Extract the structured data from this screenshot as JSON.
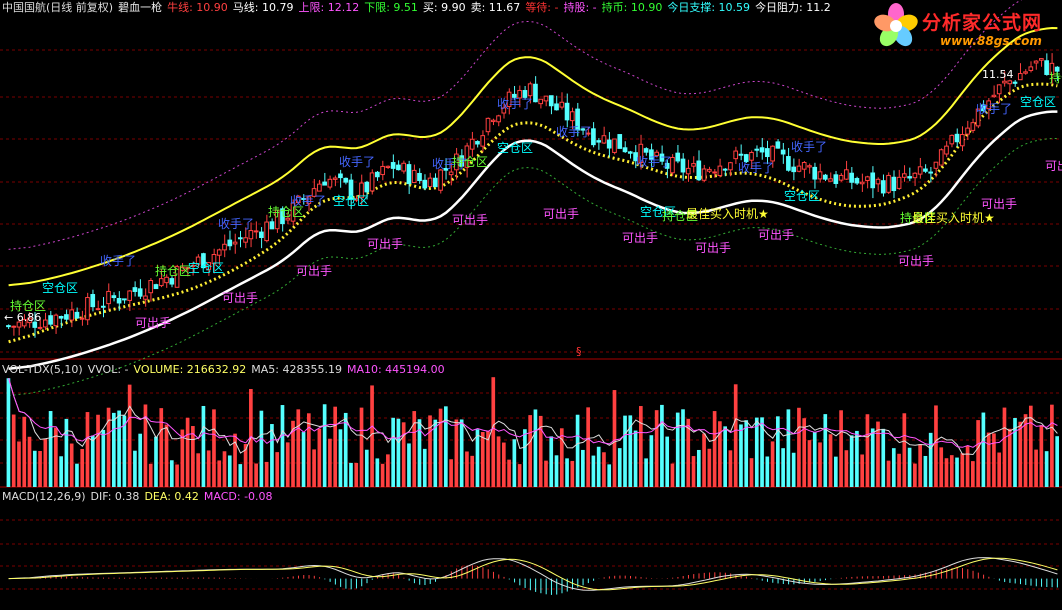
{
  "main_header": {
    "stock": "中国国航(日线 前复权)",
    "indicator": "碧血一枪",
    "items": [
      {
        "label": "牛线: ",
        "value": "10.90",
        "color": "#ff4040"
      },
      {
        "label": "马线: ",
        "value": "10.79",
        "color": "#ffffff"
      },
      {
        "label": "上限: ",
        "value": "12.12",
        "color": "#ff55ff"
      },
      {
        "label": "下限: ",
        "value": "9.51",
        "color": "#33ff33"
      },
      {
        "label": "买: ",
        "value": "9.90",
        "color": "#ffffff"
      },
      {
        "label": "卖: ",
        "value": "11.67",
        "color": "#ffffff"
      },
      {
        "label": "等待: ",
        "value": "-",
        "color": "#ff3333"
      },
      {
        "label": "持股: ",
        "value": "-",
        "color": "#ff55ff"
      },
      {
        "label": "持币: ",
        "value": "10.90",
        "color": "#33ff33"
      },
      {
        "label": "今日支撑: ",
        "value": "10.59",
        "color": "#33ffff"
      },
      {
        "label": "今日阻力: ",
        "value": "11.2",
        "color": "#ffffff"
      }
    ]
  },
  "watermark": {
    "title": "分析家公式网",
    "url": "www.88gs.com"
  },
  "main_chart": {
    "price_high_label": "11.54",
    "price_low_label": "← 6.86",
    "labels": [
      {
        "text": "持仓区",
        "color": "#66ff33",
        "x": 10,
        "y": 310
      },
      {
        "text": "空仓区",
        "color": "#00ffff",
        "x": 42,
        "y": 292
      },
      {
        "text": "收手了",
        "color": "#4466ff",
        "x": 100,
        "y": 265
      },
      {
        "text": "可出手",
        "color": "#ff55ff",
        "x": 135,
        "y": 327
      },
      {
        "text": "持仓区",
        "color": "#66ff33",
        "x": 155,
        "y": 275
      },
      {
        "text": "空仓区",
        "color": "#00ffff",
        "x": 188,
        "y": 272
      },
      {
        "text": "收手了",
        "color": "#4466ff",
        "x": 218,
        "y": 228
      },
      {
        "text": "可出手",
        "color": "#ff55ff",
        "x": 222,
        "y": 302
      },
      {
        "text": "持仓区",
        "color": "#66ff33",
        "x": 268,
        "y": 216
      },
      {
        "text": "收手了",
        "color": "#4466ff",
        "x": 290,
        "y": 205
      },
      {
        "text": "可出手",
        "color": "#ff55ff",
        "x": 296,
        "y": 275
      },
      {
        "text": "空仓区",
        "color": "#00ffff",
        "x": 333,
        "y": 205
      },
      {
        "text": "收手了",
        "color": "#4466ff",
        "x": 339,
        "y": 166
      },
      {
        "text": "可出手",
        "color": "#ff55ff",
        "x": 367,
        "y": 248
      },
      {
        "text": "收手了",
        "color": "#4466ff",
        "x": 432,
        "y": 168
      },
      {
        "text": "持仓区",
        "color": "#66ff33",
        "x": 452,
        "y": 166
      },
      {
        "text": "可出手",
        "color": "#ff55ff",
        "x": 452,
        "y": 224
      },
      {
        "text": "空仓区",
        "color": "#00ffff",
        "x": 497,
        "y": 152
      },
      {
        "text": "收手了",
        "color": "#4466ff",
        "x": 497,
        "y": 108
      },
      {
        "text": "可出手",
        "color": "#ff55ff",
        "x": 543,
        "y": 218
      },
      {
        "text": "收手了",
        "color": "#4466ff",
        "x": 556,
        "y": 136
      },
      {
        "text": "可出手",
        "color": "#ff55ff",
        "x": 622,
        "y": 242
      },
      {
        "text": "收手了",
        "color": "#4466ff",
        "x": 636,
        "y": 166
      },
      {
        "text": "空仓区",
        "color": "#00ffff",
        "x": 640,
        "y": 216
      },
      {
        "text": "持仓区",
        "color": "#66ff33",
        "x": 662,
        "y": 220
      },
      {
        "text": "最佳买入时机★",
        "color": "#ffff33",
        "x": 686,
        "y": 218
      },
      {
        "text": "可出手",
        "color": "#ff55ff",
        "x": 695,
        "y": 252
      },
      {
        "text": "收手了",
        "color": "#4466ff",
        "x": 738,
        "y": 172
      },
      {
        "text": "可出手",
        "color": "#ff55ff",
        "x": 758,
        "y": 239
      },
      {
        "text": "空仓区",
        "color": "#00ffff",
        "x": 784,
        "y": 200
      },
      {
        "text": "收手了",
        "color": "#4466ff",
        "x": 791,
        "y": 151
      },
      {
        "text": "持仓区",
        "color": "#66ff33",
        "x": 900,
        "y": 222
      },
      {
        "text": "最佳买入时机★",
        "color": "#ffff33",
        "x": 912,
        "y": 222
      },
      {
        "text": "可出手",
        "color": "#ff55ff",
        "x": 898,
        "y": 265
      },
      {
        "text": "收手了",
        "color": "#4466ff",
        "x": 976,
        "y": 113
      },
      {
        "text": "可出手",
        "color": "#ff55ff",
        "x": 981,
        "y": 208
      },
      {
        "text": "空仓区",
        "color": "#00ffff",
        "x": 1020,
        "y": 106
      },
      {
        "text": "持仓区",
        "color": "#66ff33",
        "x": 1049,
        "y": 82
      },
      {
        "text": "可出手",
        "color": "#ff55ff",
        "x": 1045,
        "y": 170
      }
    ]
  },
  "volume_header": {
    "name": "VOL-TDX(5,10)",
    "items": [
      {
        "label": "VVOL: ",
        "value": "-",
        "color": "#dddddd"
      },
      {
        "label": "VOLUME: ",
        "value": "216632.92",
        "color": "#ffff66"
      },
      {
        "label": "MA5: ",
        "value": "428355.19",
        "color": "#dddddd"
      },
      {
        "label": "MA10: ",
        "value": "445194.00",
        "color": "#ff55ff"
      }
    ]
  },
  "macd_header": {
    "name": "MACD(12,26,9)",
    "items": [
      {
        "label": "DIF: ",
        "value": "0.38",
        "color": "#dddddd"
      },
      {
        "label": "DEA: ",
        "value": "0.42",
        "color": "#ffff66"
      },
      {
        "label": "MACD: ",
        "value": "-0.08",
        "color": "#ff55ff"
      }
    ]
  },
  "separator_marker": "§",
  "colors": {
    "up": "#ff4040",
    "down": "#54ffff",
    "grid": "#7a0000",
    "pane_border": "#aa0000",
    "upper_band": "#cc44cc",
    "lower_band": "#33aa33",
    "yellow_line": "#ffff33",
    "white_line": "#ffffff"
  },
  "chart_data": {
    "type": "candlestick",
    "series": [
      {
        "name": "price_close_profile",
        "points": [
          [
            0,
            7.0
          ],
          [
            5,
            7.2
          ],
          [
            10,
            7.5
          ],
          [
            15,
            7.9
          ],
          [
            20,
            8.4
          ],
          [
            25,
            8.9
          ],
          [
            28,
            9.5
          ],
          [
            31,
            9.2
          ],
          [
            34,
            9.7
          ],
          [
            37,
            9.4
          ],
          [
            40,
            9.8
          ],
          [
            43,
            10.6
          ],
          [
            46,
            11.0
          ],
          [
            49,
            10.6
          ],
          [
            52,
            10.2
          ],
          [
            55,
            10.0
          ],
          [
            58,
            9.7
          ],
          [
            61,
            9.6
          ],
          [
            64,
            9.8
          ],
          [
            67,
            9.9
          ],
          [
            70,
            9.7
          ],
          [
            73,
            9.5
          ],
          [
            76,
            9.4
          ],
          [
            79,
            9.4
          ],
          [
            82,
            9.6
          ],
          [
            85,
            10.4
          ],
          [
            88,
            11.0
          ],
          [
            91,
            11.4
          ],
          [
            93,
            11.3
          ]
        ]
      },
      {
        "name": "VOLUME",
        "range": [
          0,
          1000000
        ]
      },
      {
        "name": "MACD",
        "range": [
          -0.4,
          0.5
        ]
      }
    ],
    "price_range": [
      6.5,
      12.2
    ],
    "last": {
      "bull_line": 10.9,
      "horse_line": 10.79,
      "upper": 12.12,
      "lower": 9.51,
      "volume": 216632.92,
      "ma5": 428355.19,
      "ma10": 445194.0,
      "dif": 0.38,
      "dea": 0.42,
      "macd": -0.08
    }
  }
}
